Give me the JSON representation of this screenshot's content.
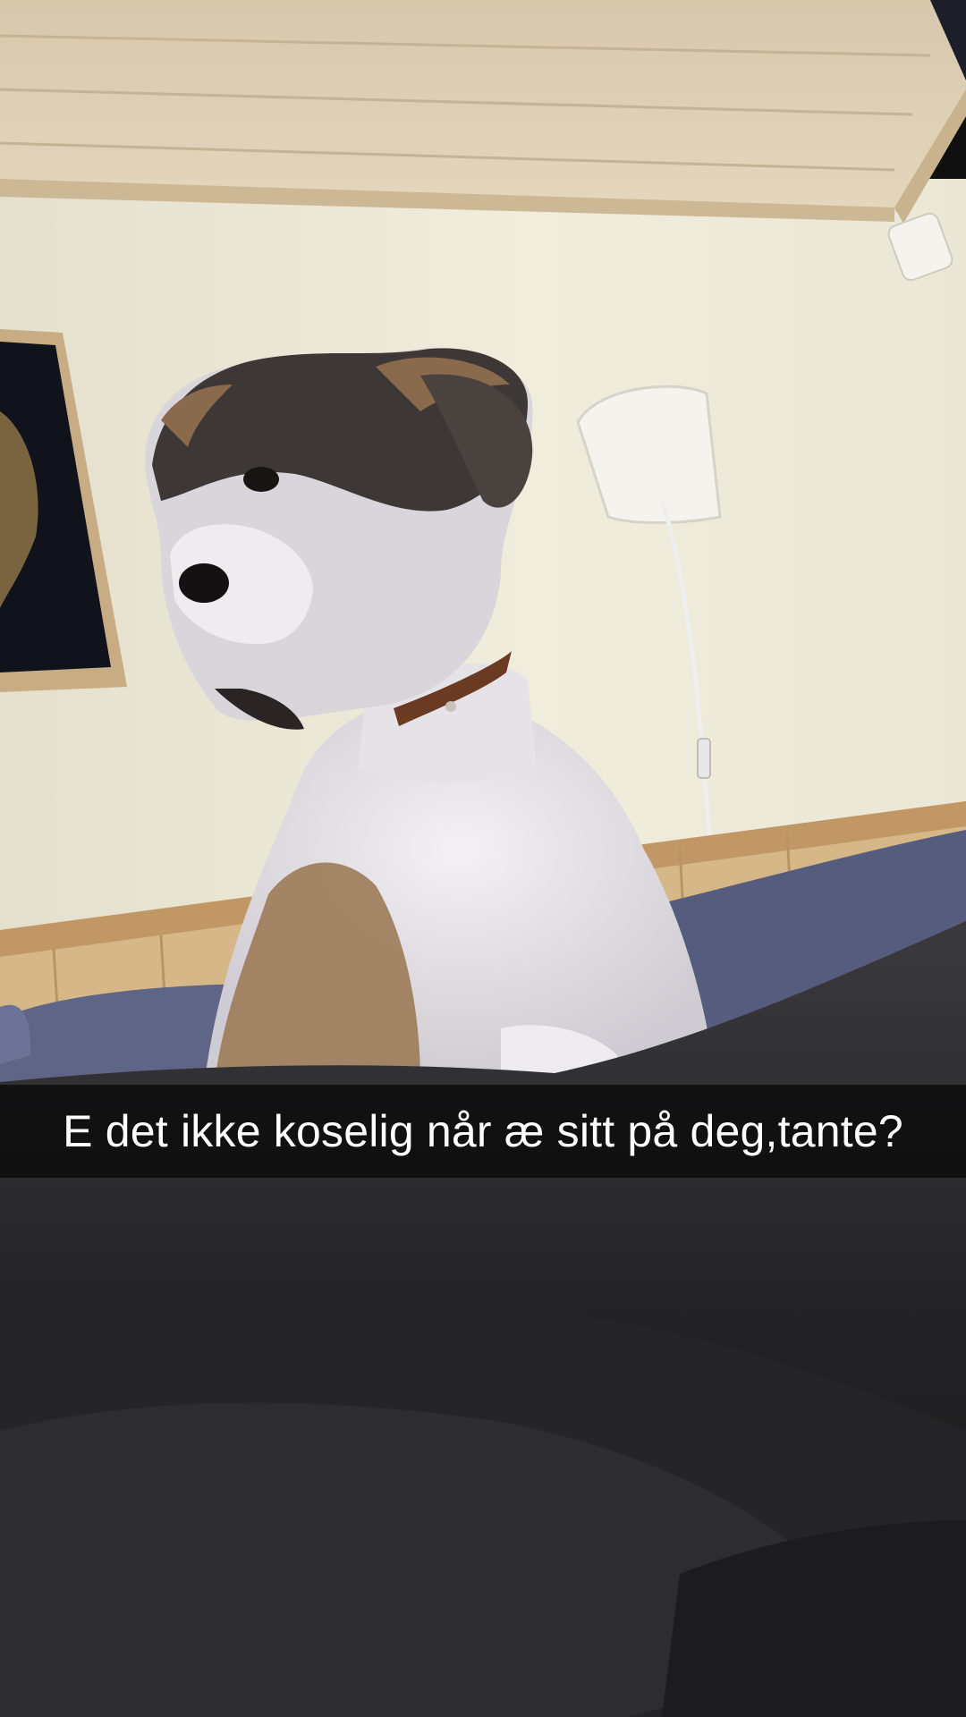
{
  "snap": {
    "caption": "E det ikke koselig når æ sitt på deg,tante?"
  },
  "photo": {
    "subject": "dog-on-sofa",
    "colors": {
      "ceiling": "#dccfb4",
      "wall": "#efebda",
      "wainscot": "#cfae84",
      "sofa": "#5f6586",
      "blanket": "#2a2a2c",
      "dog_white": "#e9e7ea",
      "dog_brown": "#8a6a4c",
      "dog_dark": "#3a3534",
      "collar": "#6b3a22"
    }
  }
}
